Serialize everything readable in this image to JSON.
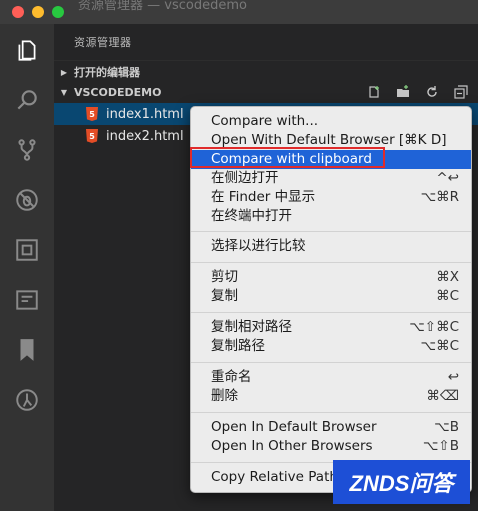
{
  "window": {
    "title": "资源管理器 — vscodedemo"
  },
  "activity_icons": [
    "files-icon",
    "search-icon",
    "source-control-icon",
    "debug-icon",
    "extensions-icon",
    "preview-icon",
    "bookmark-icon",
    "history-icon"
  ],
  "sidebar": {
    "title": "资源管理器",
    "open_editors": "打开的编辑器",
    "project": "VSCODEDEMO",
    "files": [
      {
        "name": "index1.html",
        "selected": true
      },
      {
        "name": "index2.html",
        "selected": false
      }
    ]
  },
  "context_menu": {
    "items": [
      {
        "label": "Compare with...",
        "shortcut": ""
      },
      {
        "label": "Open With Default Browser [⌘K D]",
        "shortcut": ""
      },
      {
        "label": "Compare with clipboard",
        "shortcut": ""
      },
      {
        "label": "在侧边打开",
        "shortcut": "^↩"
      },
      {
        "label": "在 Finder 中显示",
        "shortcut": "⌥⌘R"
      },
      {
        "label": "在终端中打开",
        "shortcut": ""
      },
      {
        "label": "选择以进行比较",
        "shortcut": ""
      },
      {
        "label": "剪切",
        "shortcut": "⌘X"
      },
      {
        "label": "复制",
        "shortcut": "⌘C"
      },
      {
        "label": "复制相对路径",
        "shortcut": "⌥⇧⌘C"
      },
      {
        "label": "复制路径",
        "shortcut": "⌥⌘C"
      },
      {
        "label": "重命名",
        "shortcut": "↩"
      },
      {
        "label": "删除",
        "shortcut": "⌘⌫"
      },
      {
        "label": "Open In Default Browser",
        "shortcut": "⌥B"
      },
      {
        "label": "Open In Other Browsers",
        "shortcut": "⌥⇧B"
      },
      {
        "label": "Copy Relative Path",
        "shortcut": ""
      }
    ]
  },
  "watermark": {
    "text": "ZNDS问答"
  },
  "colors": {
    "accent": "#1f63d7",
    "highlight_box": "#e02b2b",
    "selection": "#094771"
  }
}
